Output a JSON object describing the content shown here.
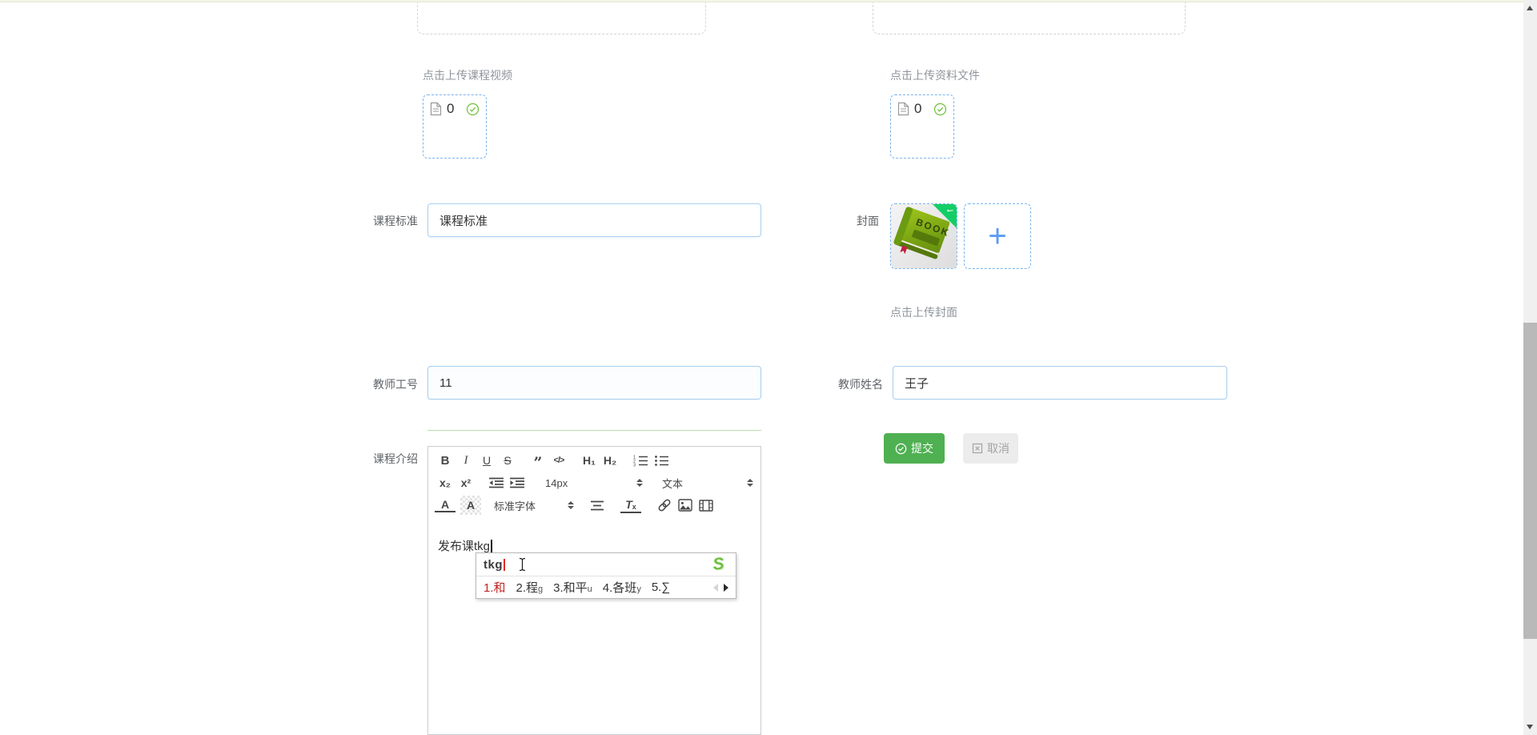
{
  "uploads": {
    "video": {
      "hint": "点击上传课程视频",
      "count": "0",
      "file_icon": "document-icon",
      "status_icon": "check-circle-icon"
    },
    "material": {
      "hint": "点击上传资料文件",
      "count": "0",
      "file_icon": "document-icon",
      "status_icon": "check-circle-icon"
    }
  },
  "form": {
    "course_standard": {
      "label": "课程标准",
      "value": "课程标准"
    },
    "cover": {
      "label": "封面",
      "hint": "点击上传封面",
      "book_title": "BOOK",
      "plus": "+"
    },
    "teacher_id": {
      "label": "教师工号",
      "value": "11"
    },
    "teacher_name": {
      "label": "教师姓名",
      "value": "王子"
    },
    "course_intro": {
      "label": "课程介绍",
      "text_before_composition": "发布课",
      "composition": "tkg"
    }
  },
  "actions": {
    "submit": "提交",
    "cancel": "取消"
  },
  "editor_toolbar": {
    "bold": "B",
    "italic": "I",
    "underline": "U",
    "strike": "S",
    "blockquote": "”",
    "code": "</>",
    "h1": "H₁",
    "h2": "H₂",
    "subscript": "x₂",
    "superscript": "x²",
    "size": "14px",
    "header": "文本",
    "color": "A",
    "background": "A",
    "font": "标准字体",
    "clean_t": "T",
    "clean_x": "x"
  },
  "ime": {
    "input": "tkg",
    "logo": "S",
    "candidates": [
      {
        "label": "1.和",
        "suffix": ""
      },
      {
        "label": "2.程",
        "suffix": "g"
      },
      {
        "label": "3.和平",
        "suffix": "u"
      },
      {
        "label": "4.各班",
        "suffix": "y"
      },
      {
        "label": "5.∑",
        "suffix": ""
      }
    ]
  },
  "colors": {
    "accent_blue": "#409eff",
    "success_green": "#4fb051",
    "upload_dash_blue": "#7ab5f0",
    "input_border_blue": "#a9cff0",
    "badge_green": "#13ce66",
    "candidate_red": "#c22222",
    "sogou_green": "#6fc03f",
    "top_strip": "#f4f4e6"
  }
}
